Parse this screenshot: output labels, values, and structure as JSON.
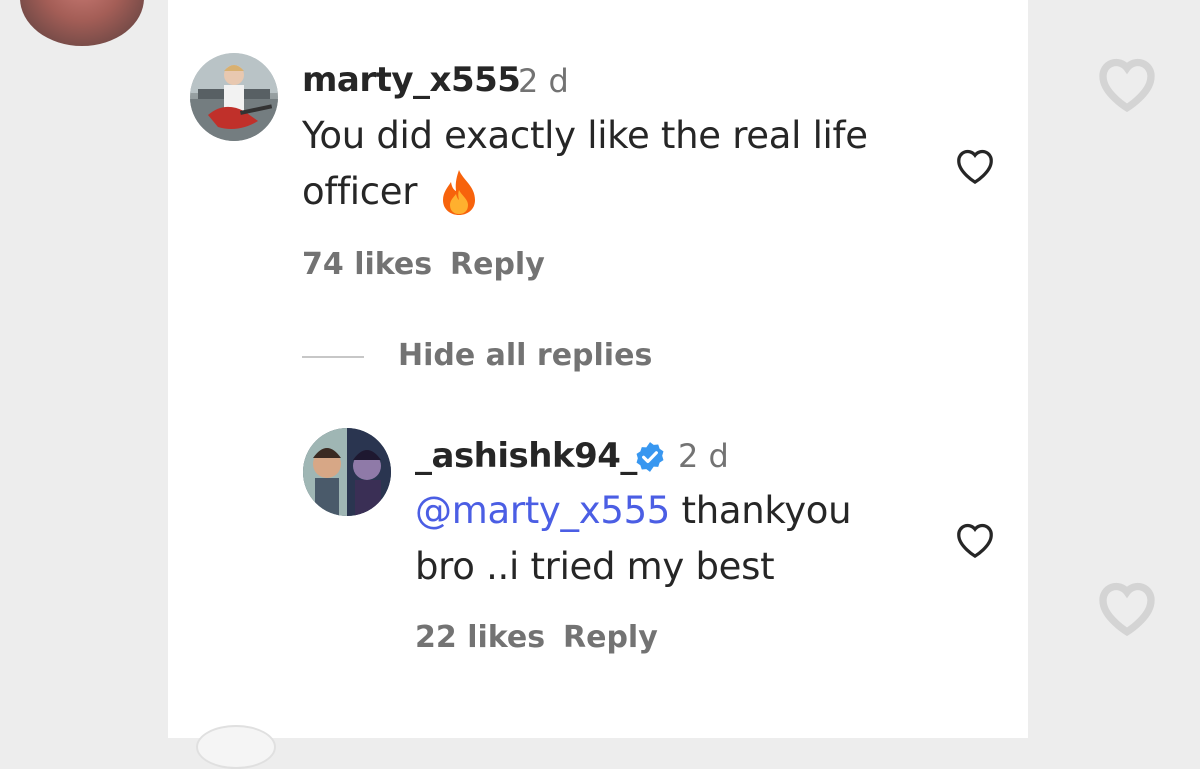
{
  "comment": {
    "username": "marty_x555",
    "time": "2 d",
    "text_line1": "You did exactly like the real life",
    "text_line2": "officer",
    "emoji": "fire-emoji",
    "likes": "74 likes",
    "reply_label": "Reply"
  },
  "thread": {
    "toggle_label": "Hide all replies"
  },
  "reply": {
    "username": "_ashishk94_",
    "verified": true,
    "time": "2 d",
    "mention": "@marty_x555",
    "text_rest_line1": " thankyou",
    "text_line2": "bro ..i tried my best",
    "likes": "22 likes",
    "reply_label": "Reply"
  },
  "colors": {
    "mention": "#4b5ee4",
    "verified": "#3897f0",
    "muted": "#737373",
    "text": "#262626"
  }
}
